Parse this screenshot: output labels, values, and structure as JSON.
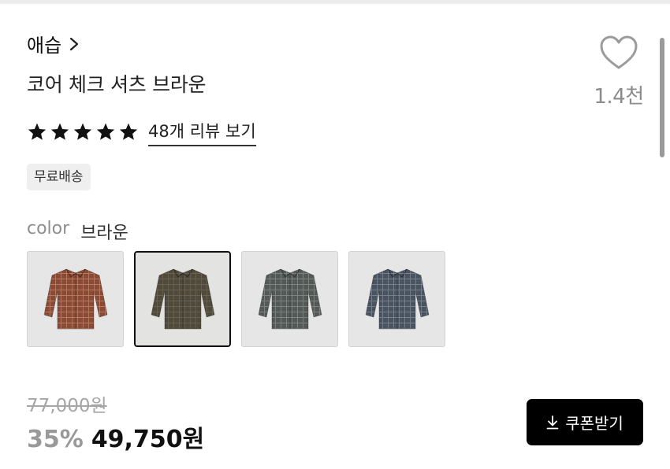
{
  "brand": {
    "name": "애습"
  },
  "product": {
    "title": "코어 체크 셔츠 브라운"
  },
  "like": {
    "count": "1.4천",
    "icon": "heart-outline-icon"
  },
  "rating": {
    "stars": 5,
    "max": 5,
    "review_link": "48개 리뷰 보기"
  },
  "badges": {
    "free_shipping": "무료배송"
  },
  "color": {
    "label": "color",
    "selected": "브라운",
    "swatches": [
      {
        "name": "red-brown-check",
        "fill": "#8a4a36",
        "line": "#d9a37f",
        "selected": false
      },
      {
        "name": "brown",
        "fill": "#4f4a3c",
        "line": "#7d725c",
        "selected": true
      },
      {
        "name": "grey-check",
        "fill": "#535956",
        "line": "#a0a69f",
        "selected": false
      },
      {
        "name": "navy-check",
        "fill": "#4a5360",
        "line": "#9aa3b0",
        "selected": false
      }
    ]
  },
  "price": {
    "original": "77,000원",
    "discount": "35%",
    "sale": "49,750원"
  },
  "coupon": {
    "label": "쿠폰받기",
    "icon": "download-icon"
  },
  "colors": {
    "accent": "#000000",
    "muted_text": "#8e8e8e",
    "badge_bg": "#efefef"
  }
}
